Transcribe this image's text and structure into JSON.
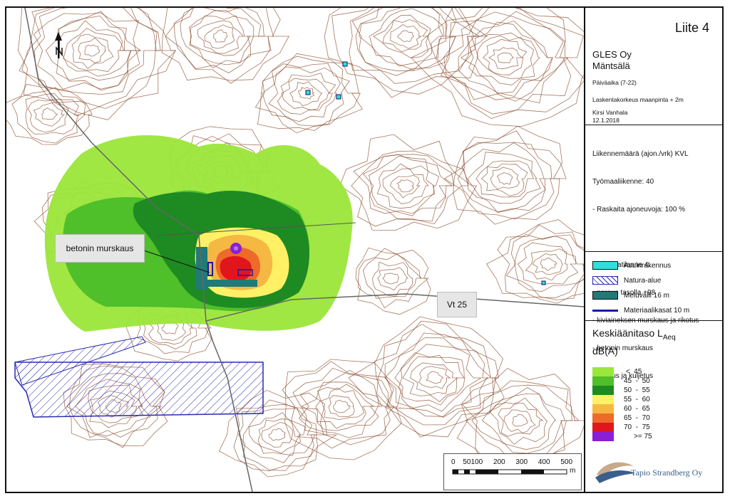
{
  "header": {
    "liite": "Liite 4",
    "company": "GLES Oy",
    "location": "Mäntsälä",
    "period": "Päiväaika (7-22)",
    "calc_height": "Laskentakorkeus maanpinta + 2m",
    "author": "Kirsi Vanhala",
    "date": "12.1.2018"
  },
  "info": {
    "lines": [
      "Liikennemäärä (ajon./vrk) KVL",
      "Työmaaliikenne: 40",
      "- Raskaita ajoneuvoja: 100 %",
      "",
      "Laskentatilanne 4:",
      "- poraus tasolla +98",
      "- kiviaineksen murskaus ja rikotus",
      "- betonin murskaus",
      "- lastaus ja kuljetus"
    ]
  },
  "legend": [
    {
      "label": "Asuinrakennus",
      "color": "#33dddd"
    },
    {
      "label": "Natura-alue",
      "color": "#2b2bb0"
    },
    {
      "label": "Meluvalli 16 m",
      "color": "#1f7a78"
    },
    {
      "label": "Materiaalikasat 10 m",
      "color": "#1a1aa8"
    }
  ],
  "noise_legend": {
    "title": "Keskiäänitaso L",
    "title_sub": "Aeq",
    "unit": "dB(A)",
    "levels": [
      {
        "label": " <  45",
        "color": "#9be63a"
      },
      {
        "label": "45  -  50",
        "color": "#4fbf2a"
      },
      {
        "label": "50  -  55",
        "color": "#1e8a22"
      },
      {
        "label": "55  -  60",
        "color": "#fff066"
      },
      {
        "label": "60  -  65",
        "color": "#f5b843"
      },
      {
        "label": "65  -  70",
        "color": "#ee6a2a"
      },
      {
        "label": "70  -  75",
        "color": "#e0161c"
      },
      {
        "label": ">= 75",
        "color": "#8a1fd6"
      }
    ]
  },
  "map": {
    "callout_concrete": "betonin murskaus",
    "callout_road": "Vt 25",
    "scale_labels": [
      "0",
      "50",
      "100",
      "200",
      "300",
      "400",
      "500"
    ],
    "scale_unit": "m"
  },
  "logo": {
    "text": "Tapio Strandberg Oy"
  },
  "colors": {
    "contour": "#8a4a2a",
    "road": "#666666",
    "natura": "#2b2bb0"
  }
}
